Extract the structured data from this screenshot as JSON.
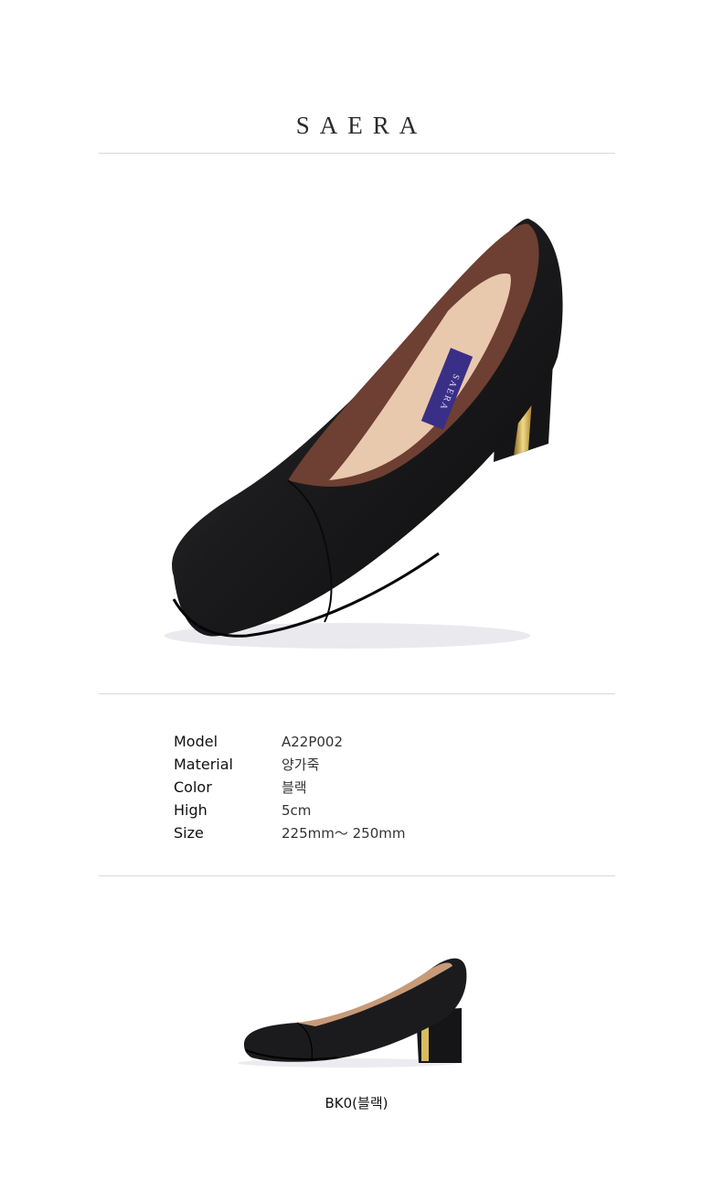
{
  "brand": "SAERA",
  "hero_image": {
    "icon": "black-pump-shoe-image",
    "insole_logo": "SAERA"
  },
  "specs": [
    {
      "label": "Model",
      "value": "A22P002"
    },
    {
      "label": "Material",
      "value": "양가죽"
    },
    {
      "label": "Color",
      "value": "블랙"
    },
    {
      "label": "High",
      "value": "5cm"
    },
    {
      "label": "Size",
      "value": "225mm～ 250mm"
    }
  ],
  "variant": {
    "icon": "black-pump-side-image",
    "label": "BK0(블랙)"
  },
  "colors": {
    "leather": "#1c1c1e",
    "lining": "#e9c9ad",
    "inner": "#6e3f33",
    "gold": "#c9a645",
    "label_bg": "#3a2f86"
  }
}
